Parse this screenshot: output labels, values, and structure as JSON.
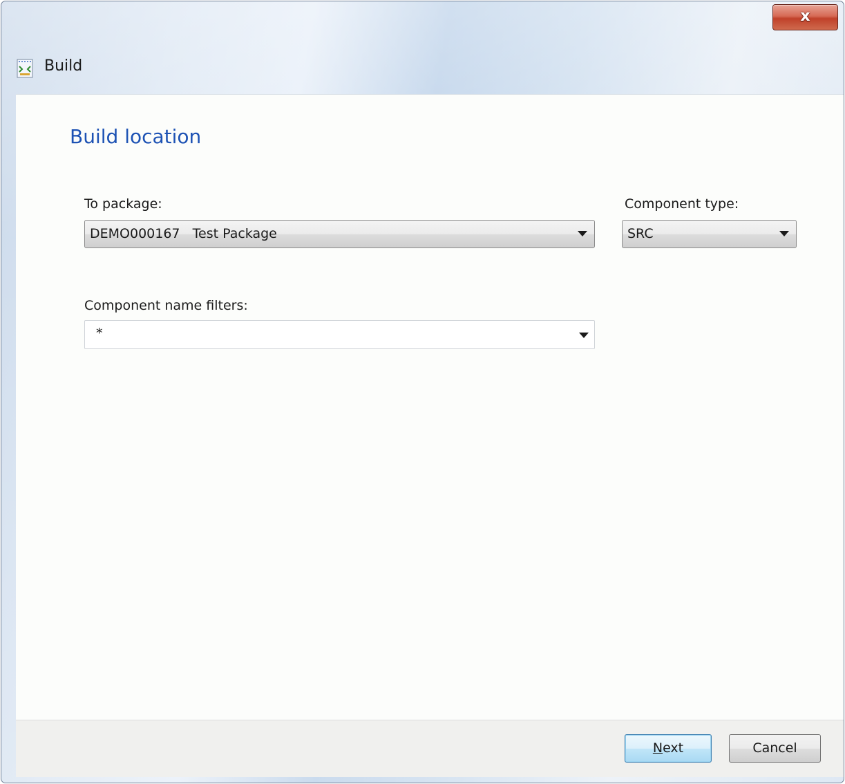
{
  "window": {
    "title": "Build",
    "close_label": "x"
  },
  "page": {
    "heading": "Build location"
  },
  "form": {
    "to_package_label": "To package:",
    "to_package_value": "DEMO000167   Test Package",
    "component_type_label": "Component type:",
    "component_type_value": "SRC",
    "component_name_filters_label": "Component name filters:",
    "component_name_filters_value": "*"
  },
  "footer": {
    "next_mnemonic": "N",
    "next_rest": "ext",
    "cancel_label": "Cancel"
  },
  "icons": {
    "window_icon": "build-icon",
    "dropdown_arrow": "chevron-down-icon",
    "close": "close-icon"
  },
  "colors": {
    "heading": "#1d52b4",
    "close_button": "#c0412a",
    "next_border": "#3c7fb1"
  }
}
